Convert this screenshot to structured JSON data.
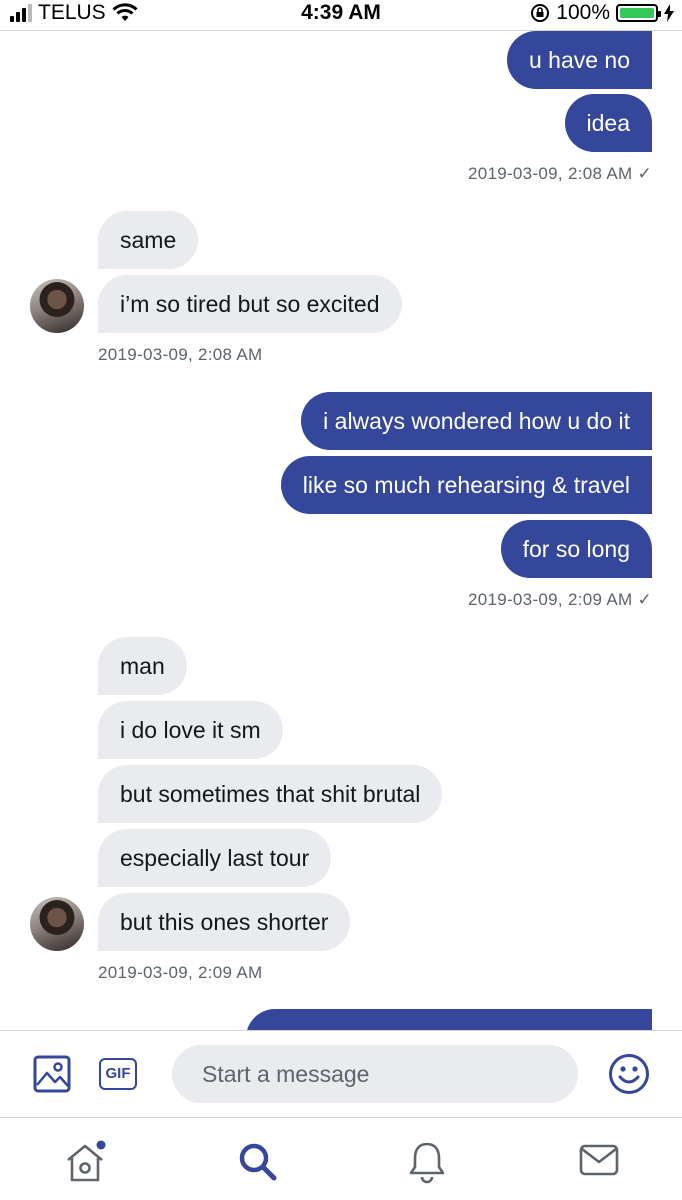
{
  "status_bar": {
    "carrier": "TELUS",
    "time": "4:39 AM",
    "battery": "100%"
  },
  "conversation": {
    "groups": [
      {
        "direction": "outgoing",
        "messages": [
          "u have no",
          "idea"
        ],
        "timestamp": "2019-03-09, 2:08 AM ✓"
      },
      {
        "direction": "incoming",
        "messages": [
          "same",
          "i’m so tired but so excited"
        ],
        "timestamp": "2019-03-09, 2:08 AM"
      },
      {
        "direction": "outgoing",
        "messages": [
          "i always wondered how u do it",
          "like so much rehearsing & travel",
          "for so long"
        ],
        "timestamp": "2019-03-09, 2:09 AM ✓"
      },
      {
        "direction": "incoming",
        "messages": [
          "man",
          "i do love it sm",
          "but sometimes that shit brutal",
          "especially last tour",
          "but this ones shorter"
        ],
        "timestamp": "2019-03-09, 2:09 AM"
      }
    ]
  },
  "compose": {
    "gif_label": "GIF",
    "placeholder": "Start a message"
  },
  "colors": {
    "accent": "#34479b",
    "incoming_bubble": "#e9ebef",
    "battery": "#34c759"
  },
  "icons": {
    "media": "image-icon",
    "emoji": "smiley-icon",
    "tabs": [
      "home-icon",
      "search-icon",
      "notifications-bell-icon",
      "messages-envelope-icon"
    ]
  }
}
